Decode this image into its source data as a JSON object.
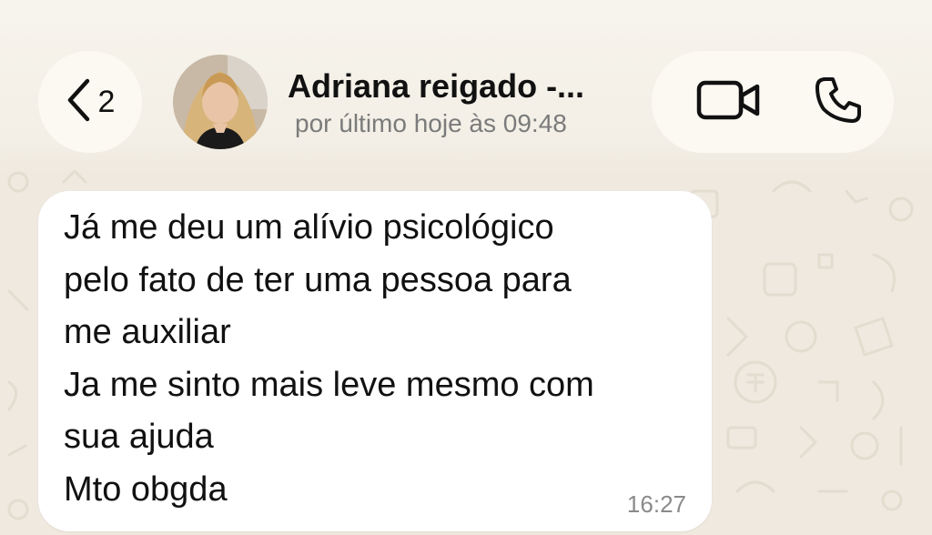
{
  "header": {
    "back_count": "2",
    "contact_name": "Adriana reigado -...",
    "status": "por último hoje às 09:48",
    "icons": {
      "back": "chevron-left-icon",
      "video": "video-call-icon",
      "phone": "phone-icon"
    }
  },
  "message": {
    "lines": [
      "Já me deu um alívio psicológico",
      "pelo fato de ter uma pessoa para",
      "me auxiliar",
      "Ja me sinto mais leve mesmo com",
      "sua ajuda",
      "Mto obgda"
    ],
    "time": "16:27"
  },
  "colors": {
    "wallpaper": "#efe9df",
    "header_pill": "#fbf9f2",
    "bubble": "#ffffff",
    "text": "#111111",
    "muted": "#7b7b7b"
  }
}
